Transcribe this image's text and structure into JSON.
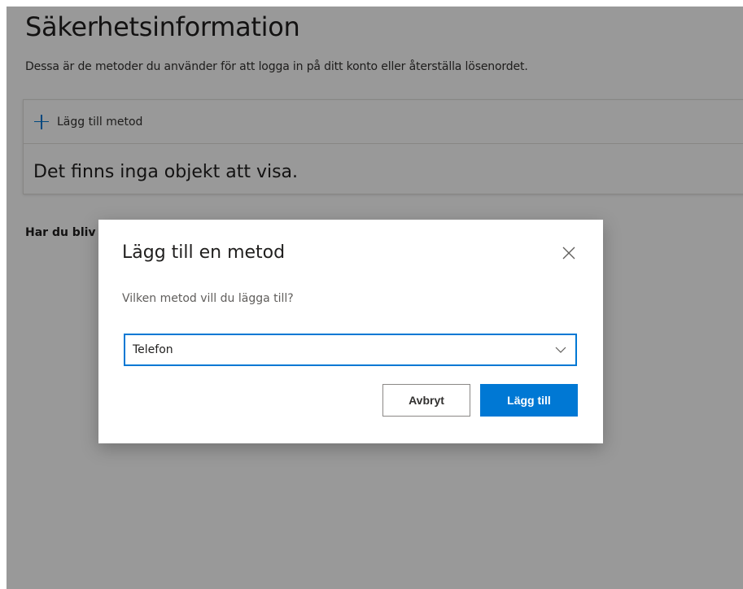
{
  "page": {
    "title": "Säkerhetsinformation",
    "description": "Dessa är de metoder du använder för att logga in på ditt konto eller återställa lösenordet.",
    "add_method_label": "Lägg till metod",
    "empty_text": "Det finns inga objekt att visa.",
    "lost_device_text": "Har du bliv"
  },
  "dialog": {
    "title": "Lägg till en metod",
    "question": "Vilken metod vill du lägga till?",
    "select_value": "Telefon",
    "cancel_label": "Avbryt",
    "add_label": "Lägg till"
  },
  "icons": {
    "plus": "plus-icon",
    "close": "close-icon",
    "chevron": "chevron-down-icon"
  },
  "colors": {
    "accent": "#0078d4",
    "overlay": "rgba(0,0,0,0.4)"
  }
}
